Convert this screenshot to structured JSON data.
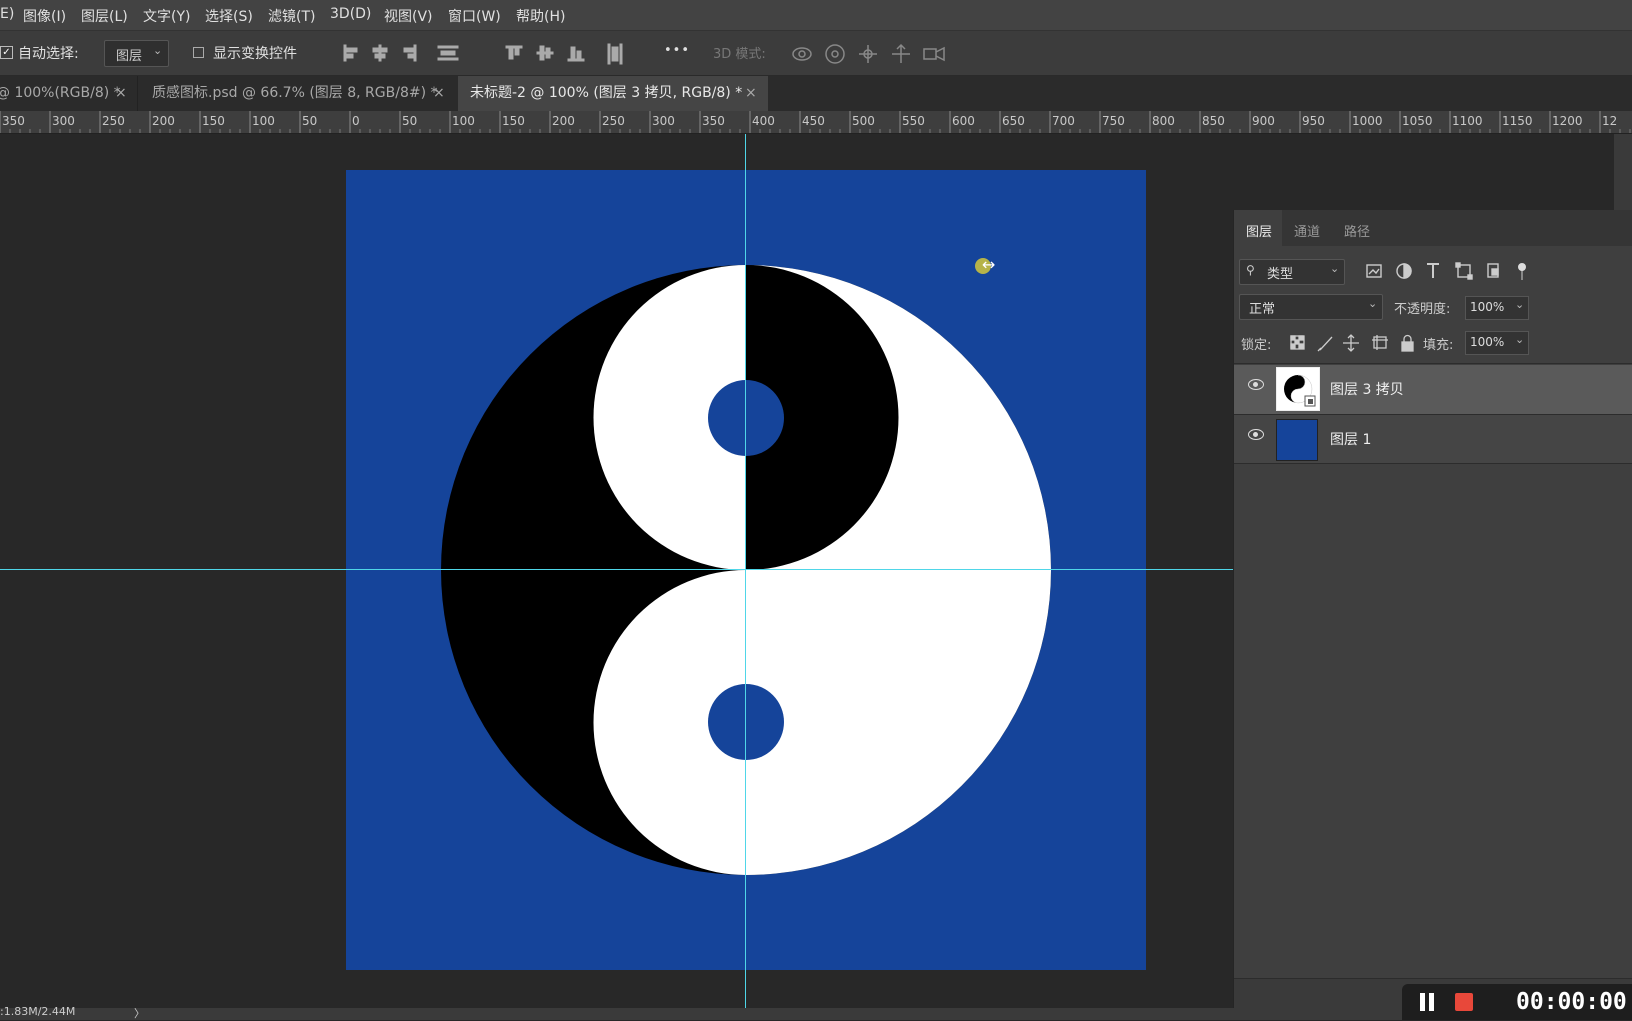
{
  "menu": {
    "items": [
      "E)",
      "图像(I)",
      "图层(L)",
      "文字(Y)",
      "选择(S)",
      "滤镜(T)",
      "3D(D)",
      "视图(V)",
      "窗口(W)",
      "帮助(H)"
    ]
  },
  "options": {
    "auto_select_label": "自动选择:",
    "auto_select_checked": true,
    "auto_select_value": "图层",
    "show_transform_label": "显示变换控件",
    "show_transform_checked": false,
    "more_label": "•••",
    "mode_3d_label": "3D 模式:"
  },
  "tabs": [
    {
      "label": "@ 100%(RGB/8) *",
      "close": "×"
    },
    {
      "label": "质感图标.psd @ 66.7% (图层 8, RGB/8#) *",
      "close": "×"
    },
    {
      "label": "未标题-2 @ 100% (图层 3 拷贝, RGB/8) *",
      "close": "×"
    }
  ],
  "ruler": {
    "labels": [
      "350",
      "300",
      "250",
      "200",
      "150",
      "100",
      "50",
      "0",
      "50",
      "100",
      "150",
      "200",
      "250",
      "300",
      "350",
      "400",
      "450",
      "500",
      "550",
      "600",
      "650",
      "700",
      "750",
      "800",
      "850",
      "900",
      "950",
      "1000",
      "1050",
      "1100",
      "1150",
      "1200",
      "12"
    ]
  },
  "canvas": {
    "background_color": "#15449a",
    "guide_color": "#4fd6e8"
  },
  "layers_panel": {
    "tabs": [
      "图层",
      "通道",
      "路径"
    ],
    "filter_label": "类型",
    "blend_mode": "正常",
    "opacity_label": "不透明度:",
    "opacity_value": "100%",
    "lock_label": "锁定:",
    "fill_label": "填充:",
    "fill_value": "100%",
    "layers": [
      {
        "name": "图层 3 拷贝",
        "visible": true,
        "selected": true,
        "thumb": "yin-yang"
      },
      {
        "name": "图层 1",
        "visible": true,
        "selected": false,
        "thumb": "blue-fill"
      }
    ]
  },
  "status": {
    "doc_size": ":1.83M/2.44M"
  },
  "recorder": {
    "time": "00:00:00"
  }
}
